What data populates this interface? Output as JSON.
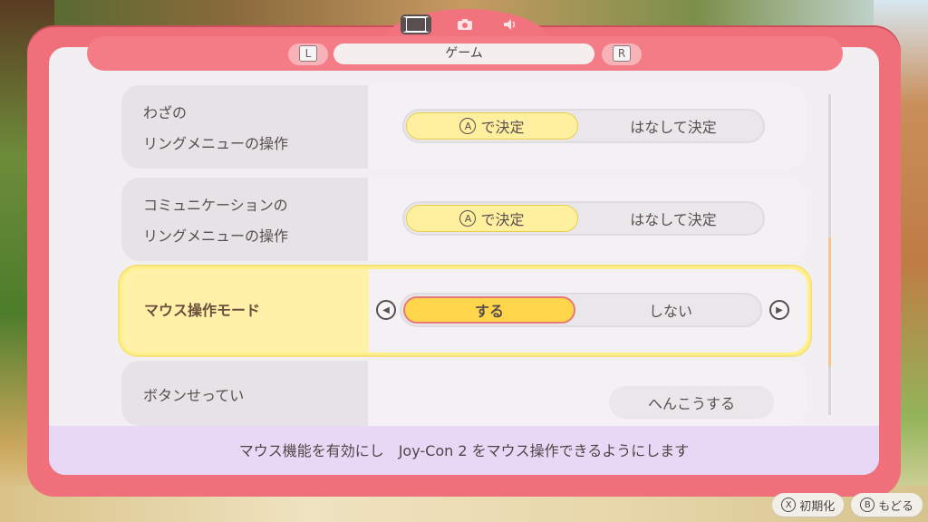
{
  "tabs": {
    "icons": [
      "console-icon",
      "camera-icon",
      "speaker-icon"
    ]
  },
  "header": {
    "left_key": "L",
    "right_key": "R",
    "title": "ゲーム"
  },
  "rows": [
    {
      "label_line1": "わざの",
      "label_line2": "リングメニューの操作",
      "option_on": "で決定",
      "option_off": "はなして決定",
      "badge": "A"
    },
    {
      "label_line1": "コミュニケーションの",
      "label_line2": "リングメニューの操作",
      "option_on": "で決定",
      "option_off": "はなして決定",
      "badge": "A"
    },
    {
      "label": "マウス操作モード",
      "option_on": "する",
      "option_off": "しない"
    },
    {
      "label": "ボタンせってい",
      "button": "へんこうする"
    }
  ],
  "footer": {
    "text": "マウス機能を有効にし　Joy-Con 2 をマウス操作できるようにします"
  },
  "bottom": {
    "reset_key": "X",
    "reset_label": "初期化",
    "back_key": "B",
    "back_label": "もどる"
  },
  "colors": {
    "frame": "#ef6f7a",
    "selected_row": "#fff1a8",
    "selected_option": "#ffd54a",
    "footer": "#e9d8f5"
  }
}
